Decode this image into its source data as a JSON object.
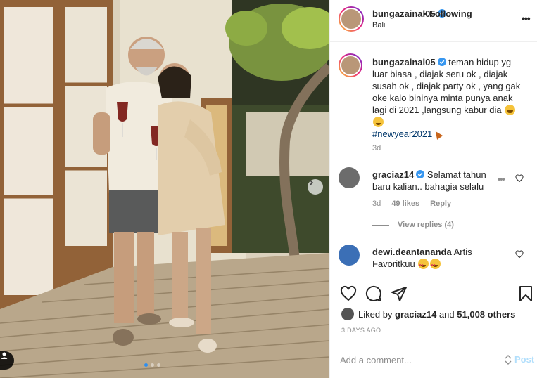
{
  "post": {
    "username": "bungazainal05",
    "follow_status": "Following",
    "location": "Bali",
    "more_label": "•••"
  },
  "caption": {
    "username": "bungazainal05",
    "text": "teman hidup yg luar biasa , diajak seru ok , diajak susah ok , diajak party ok , yang gak oke kalo bininya minta punya anak lagi di 2021 ,langsung kabur dia",
    "hashtag": "#newyear2021",
    "time": "3d"
  },
  "comments": [
    {
      "username": "graciaz14",
      "text": "Selamat tahun baru kalian.. bahagia selalu",
      "time": "3d",
      "likes": "49 likes",
      "reply_label": "Reply",
      "view_replies": "View replies (4)"
    },
    {
      "username": "dewi.deantananda",
      "text": "Artis Favoritkuu"
    }
  ],
  "likes_summary": {
    "prefix": "Liked by",
    "user": "graciaz14",
    "conjunction": "and",
    "others": "51,008 others"
  },
  "time_ago": "3 DAYS AGO",
  "add_comment": {
    "placeholder": "Add a comment...",
    "post_label": "Post"
  },
  "icons": {
    "like": "heart-icon",
    "comment": "comment-icon",
    "share": "paper-plane-icon",
    "save": "bookmark-icon",
    "verified": "verified-badge-icon",
    "next": "chevron-right-icon",
    "tag": "user-tag-icon",
    "emoji": "emoji-icon"
  },
  "colors": {
    "verified_blue": "#3897f0",
    "hashtag": "#00376b",
    "post_disabled": "#b2dffc",
    "meta_gray": "#8e8e8e"
  }
}
